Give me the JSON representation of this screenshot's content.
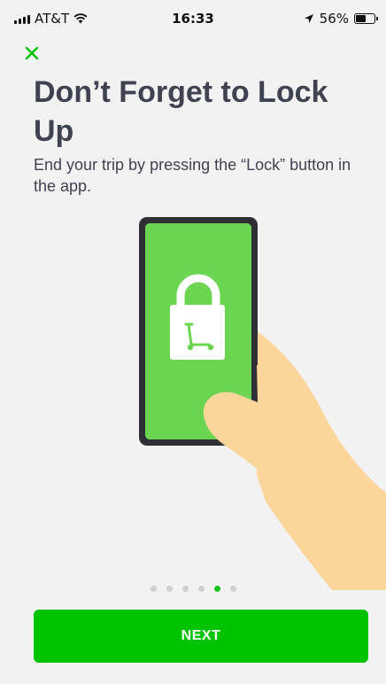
{
  "status_bar": {
    "carrier": "AT&T",
    "time": "16:33",
    "battery": "56%",
    "battery_level": 0.56,
    "icons": [
      "signal-icon",
      "wifi-icon",
      "location-arrow-icon",
      "battery-icon"
    ]
  },
  "onboarding": {
    "title": "Don’t Forget to Lock Up",
    "subtitle": "End your trip by pressing the “Lock” button in the app.",
    "page_count": 6,
    "current_page": 5,
    "next_label": "NEXT"
  },
  "colors": {
    "accent": "#00c300",
    "screen_green": "#6bd552",
    "text": "#3f4250",
    "background": "#f2f2f2",
    "skin": "#fbd59a",
    "phone_frame": "#2f3035"
  }
}
